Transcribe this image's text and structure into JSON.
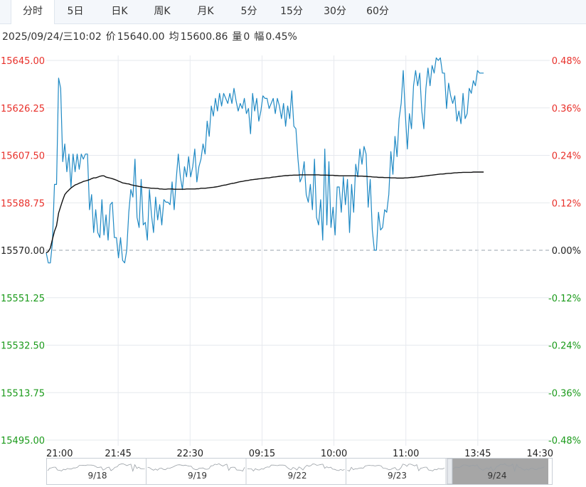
{
  "tabs": [
    {
      "label": "分时",
      "active": true
    },
    {
      "label": "5日"
    },
    {
      "label": "日K"
    },
    {
      "label": "周K"
    },
    {
      "label": "月K"
    },
    {
      "label": "5分"
    },
    {
      "label": "15分"
    },
    {
      "label": "30分"
    },
    {
      "label": "60分"
    }
  ],
  "info": {
    "datetime": "2025/09/24/三10:02",
    "price_label": "价",
    "price": "15640.00",
    "avg_label": "均",
    "avg": "15600.86",
    "vol_label": "量",
    "vol": "0",
    "amp_label": "幅",
    "amp": "0.45%"
  },
  "colors": {
    "up": "#e8302a",
    "down": "#1a9a1a",
    "price_line": "#1f89c4",
    "avg_line": "#111111",
    "grid": "#e6e9ee"
  },
  "chart_data": {
    "type": "line",
    "prev_close": 15570.0,
    "ylim": [
      15495.0,
      15645.0
    ],
    "y_ticks_left": [
      "15645.00",
      "15626.25",
      "15607.50",
      "15588.75",
      "15570.00",
      "15551.25",
      "15532.50",
      "15513.75",
      "15495.00"
    ],
    "y_ticks_right": [
      "0.48%",
      "0.36%",
      "0.24%",
      "0.12%",
      "0.00%",
      "-0.12%",
      "-0.24%",
      "-0.36%",
      "-0.48%"
    ],
    "x_ticks": [
      "21:00",
      "21:45",
      "22:30",
      "09:15",
      "10:00",
      "11:00",
      "13:45",
      "14:30"
    ],
    "series": [
      {
        "key": "price",
        "values": [
          15569,
          15565,
          15565,
          15573,
          15596,
          15596,
          15638,
          15634,
          15605,
          15612,
          15601,
          15608,
          15595,
          15608,
          15601,
          15608,
          15602,
          15608,
          15606,
          15608,
          15608,
          15586,
          15592,
          15577,
          15586,
          15577,
          15575,
          15590,
          15576,
          15584,
          15574,
          15588,
          15589,
          15575,
          15575,
          15567,
          15575,
          15566,
          15565,
          15570,
          15585,
          15594,
          15591,
          15606,
          15583,
          15579,
          15598,
          15580,
          15581,
          15574,
          15594,
          15584,
          15577,
          15591,
          15582,
          15588,
          15580,
          15590,
          15589,
          15589,
          15588,
          15597,
          15586,
          15598,
          15608,
          15599,
          15594,
          15603,
          15599,
          15607,
          15599,
          15603,
          15610,
          15597,
          15603,
          15606,
          15612,
          15608,
          15621,
          15615,
          15627,
          15623,
          15630,
          15625,
          15632,
          15627,
          15632,
          15630,
          15628,
          15632,
          15628,
          15634,
          15629,
          15625,
          15628,
          15626,
          15630,
          15624,
          15626,
          15616,
          15632,
          15625,
          15630,
          15621,
          15625,
          15631,
          15630,
          15630,
          15626,
          15628,
          15630,
          15624,
          15630,
          15627,
          15622,
          15628,
          15619,
          15627,
          15622,
          15633,
          15619,
          15618,
          15606,
          15597,
          15599,
          15605,
          15592,
          15589,
          15596,
          15586,
          15606,
          15583,
          15580,
          15590,
          15574,
          15610,
          15580,
          15605,
          15579,
          15587,
          15576,
          15595,
          15595,
          15585,
          15599,
          15588,
          15598,
          15577,
          15596,
          15585,
          15604,
          15599,
          15610,
          15604,
          15611,
          15608,
          15587,
          15598,
          15578,
          15570,
          15570,
          15585,
          15578,
          15579,
          15586,
          15585,
          15592,
          15609,
          15600,
          15615,
          15607,
          15622,
          15628,
          15641,
          15624,
          15610,
          15624,
          15618,
          15635,
          15641,
          15635,
          15640,
          15625,
          15618,
          15634,
          15642,
          15635,
          15643,
          15640,
          15646,
          15645,
          15646,
          15640,
          15640,
          15626,
          15636,
          15631,
          15628,
          15631,
          15621,
          15625,
          15620,
          15632,
          15622,
          15624,
          15634,
          15632,
          15637,
          15635,
          15641,
          15640,
          15640,
          15640
        ]
      },
      {
        "key": "avg",
        "values": [
          15569.0,
          15569.5,
          15570.9,
          15574.3,
          15577.5,
          15579.7,
          15584.7,
          15587.3,
          15589.8,
          15592.0,
          15593.0,
          15593.8,
          15594.6,
          15595.2,
          15595.8,
          15596.1,
          15596.5,
          15596.8,
          15597.2,
          15597.4,
          15597.6,
          15597.9,
          15598.3,
          15598.6,
          15598.6,
          15598.9,
          15599.2,
          15599.4,
          15599.4,
          15598.9,
          15598.7,
          15598.5,
          15598.3,
          15598.0,
          15597.7,
          15597.3,
          15597.0,
          15596.6,
          15596.5,
          15596.3,
          15596.2,
          15595.9,
          15595.7,
          15595.5,
          15595.4,
          15595.2,
          15595.1,
          15594.9,
          15594.8,
          15594.7,
          15594.6,
          15594.5,
          15594.5,
          15594.4,
          15594.4,
          15594.2,
          15594.2,
          15594.1,
          15594.1,
          15594.2,
          15594.2,
          15594.2,
          15594.1,
          15594.1,
          15594.1,
          15594.1,
          15594.1,
          15594.1,
          15594.2,
          15594.2,
          15594.2,
          15594.2,
          15594.2,
          15594.3,
          15594.3,
          15594.5,
          15594.5,
          15594.5,
          15594.6,
          15594.7,
          15594.8,
          15594.9,
          15595.0,
          15595.1,
          15595.3,
          15595.5,
          15595.7,
          15595.8,
          15596.0,
          15596.2,
          15596.4,
          15596.5,
          15596.7,
          15596.9,
          15597.1,
          15597.2,
          15597.4,
          15597.5,
          15597.6,
          15597.8,
          15597.9,
          15598.0,
          15598.1,
          15598.2,
          15598.3,
          15598.4,
          15598.5,
          15598.6,
          15598.6,
          15598.8,
          15598.9,
          15599.0,
          15599.1,
          15599.2,
          15599.3,
          15599.4,
          15599.5,
          15599.5,
          15599.6,
          15599.6,
          15599.7,
          15599.7,
          15599.7,
          15599.8,
          15599.8,
          15599.8,
          15599.8,
          15599.8,
          15599.8,
          15599.8,
          15599.8,
          15599.8,
          15599.8,
          15599.7,
          15599.7,
          15599.7,
          15599.7,
          15599.6,
          15599.6,
          15599.6,
          15599.5,
          15599.5,
          15599.4,
          15599.4,
          15599.4,
          15599.4,
          15599.4,
          15599.4,
          15599.4,
          15599.4,
          15599.4,
          15599.3,
          15599.3,
          15599.3,
          15599.2,
          15599.2,
          15599.1,
          15599.1,
          15599.0,
          15598.9,
          15598.9,
          15598.8,
          15598.8,
          15598.8,
          15598.7,
          15598.7,
          15598.7,
          15598.6,
          15598.6,
          15598.6,
          15598.5,
          15598.5,
          15598.5,
          15598.5,
          15598.6,
          15598.6,
          15598.7,
          15598.8,
          15598.8,
          15598.9,
          15599.0,
          15599.1,
          15599.2,
          15599.3,
          15599.4,
          15599.5,
          15599.6,
          15599.7,
          15599.8,
          15599.9,
          15600.0,
          15600.1,
          15600.1,
          15600.2,
          15600.3,
          15600.4,
          15600.4,
          15600.5,
          15600.6,
          15600.6,
          15600.7,
          15600.7,
          15600.8,
          15600.8,
          15600.8,
          15600.8,
          15600.8,
          15600.9,
          15600.9,
          15600.9,
          15600.9,
          15600.9,
          15600.9
        ]
      }
    ],
    "navigator": {
      "labels": [
        "9/18",
        "9/19",
        "9/22",
        "9/23",
        "9/24"
      ],
      "selected": "9/24"
    }
  }
}
